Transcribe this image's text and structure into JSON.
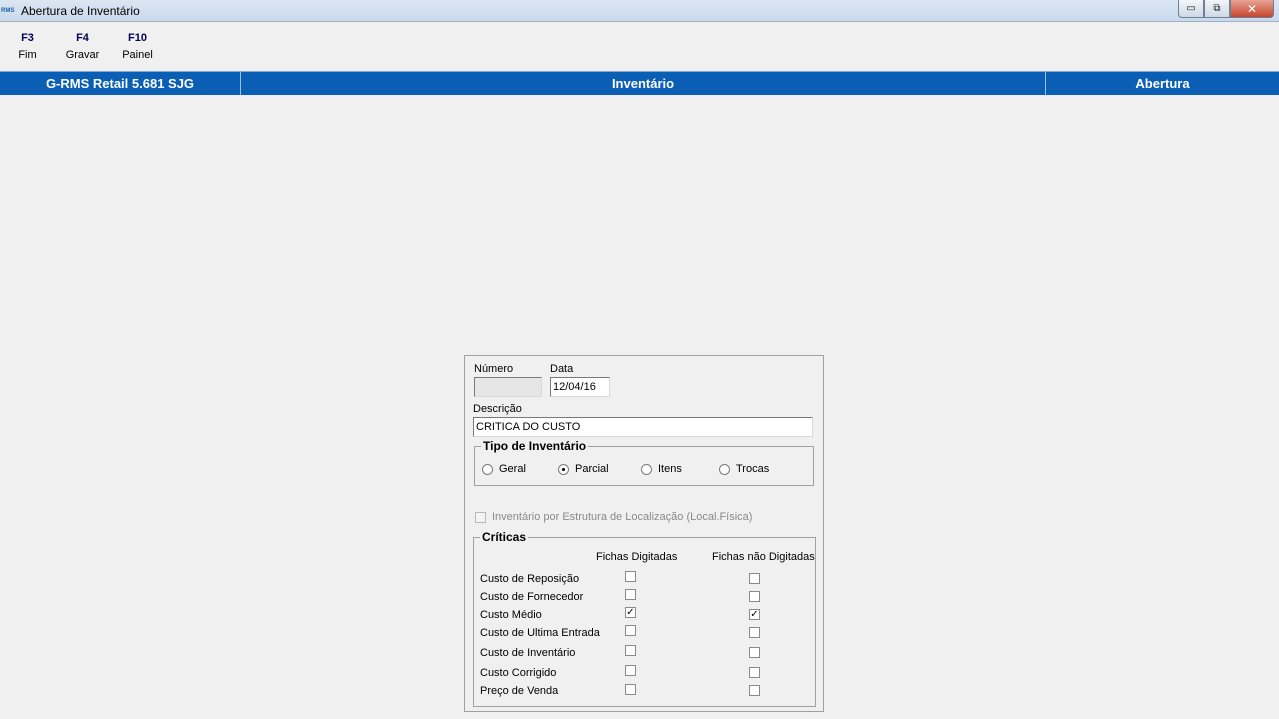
{
  "window": {
    "title": "Abertura de Inventário",
    "app_icon": "RMS",
    "minimize_glyph": "▭",
    "restore_glyph": "⧉",
    "close_glyph": "✕"
  },
  "toolbar": {
    "keys": [
      {
        "key": "F3",
        "label": "Fim"
      },
      {
        "key": "F4",
        "label": "Gravar"
      },
      {
        "key": "F10",
        "label": "Painel"
      }
    ]
  },
  "header": {
    "system": "G-RMS Retail 5.681 SJG",
    "module": "Inventário",
    "action": "Abertura"
  },
  "form": {
    "numero_label": "Número",
    "numero_value": "",
    "data_label": "Data",
    "data_value": "12/04/16",
    "descricao_label": "Descrição",
    "descricao_value": "CRITICA DO CUSTO",
    "tipo_title": "Tipo de Inventário",
    "tipo_options": [
      {
        "label": "Geral",
        "selected": false
      },
      {
        "label": "Parcial",
        "selected": true
      },
      {
        "label": "Itens",
        "selected": false
      },
      {
        "label": "Trocas",
        "selected": false
      }
    ],
    "estrutura_label": "Inventário por Estrutura de Localização (Local.Física)",
    "estrutura_checked": false,
    "criticas_title": "Críticas",
    "col_digitadas": "Fichas Digitadas",
    "col_nao_digitadas": "Fichas não Digitadas",
    "criticas": [
      {
        "label": "Custo de Reposição",
        "digitadas": false,
        "nao_digitadas": false
      },
      {
        "label": "Custo de Fornecedor",
        "digitadas": false,
        "nao_digitadas": false
      },
      {
        "label": "Custo Médio",
        "digitadas": true,
        "nao_digitadas": true
      },
      {
        "label": "Custo de Ultima Entrada",
        "digitadas": false,
        "nao_digitadas": false
      },
      {
        "label": "Custo de Inventário",
        "digitadas": false,
        "nao_digitadas": false
      },
      {
        "label": "Custo Corrigido",
        "digitadas": false,
        "nao_digitadas": false
      },
      {
        "label": "Preço de Venda",
        "digitadas": false,
        "nao_digitadas": false
      }
    ],
    "check_glyph": "✓"
  },
  "colors": {
    "header_blue": "#0a5fb4",
    "fkey_text": "#00005a"
  }
}
